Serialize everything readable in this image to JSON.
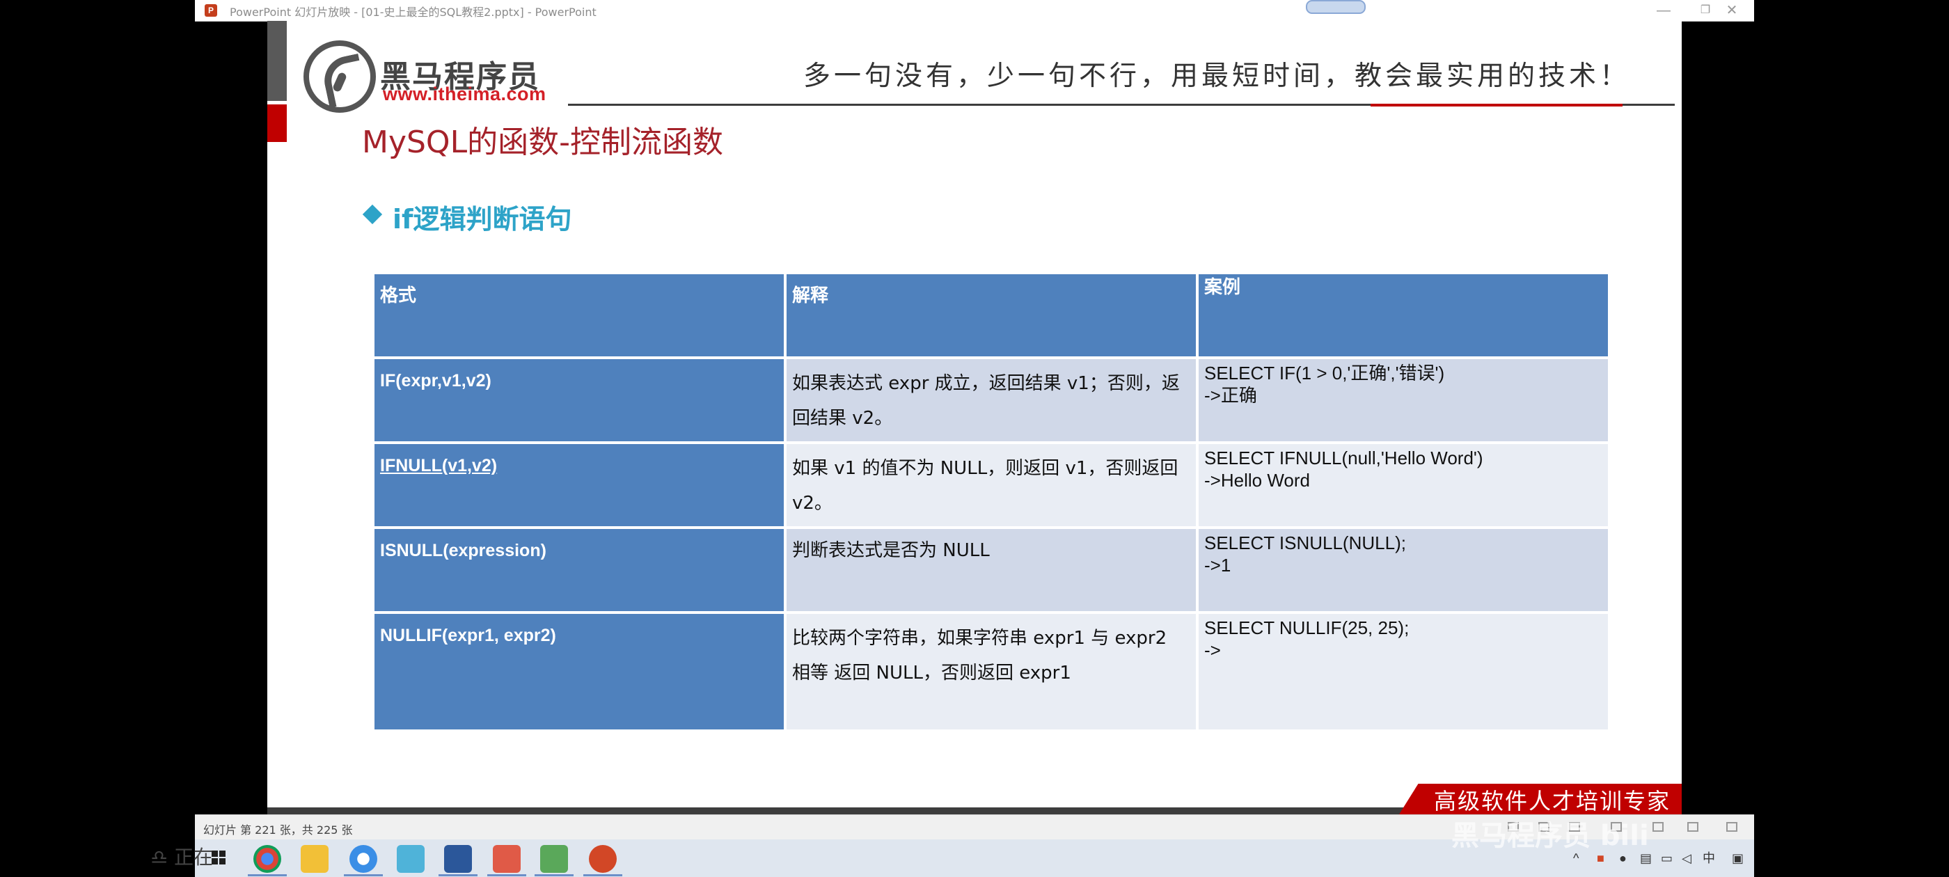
{
  "window": {
    "title": "PowerPoint 幻灯片放映 - [01-史上最全的SQL教程2.pptx] - PowerPoint",
    "app_icon": "P",
    "minimize": "—",
    "restore": "❐",
    "close": "✕"
  },
  "slide": {
    "logo_name": "黑马程序员",
    "logo_url": "www.itheima.com",
    "slogan": "多一句没有，少一句不行，用最短时间，教会最实用的技术！",
    "title": "MySQL的函数-控制流函数",
    "subtitle": "if逻辑判断语句",
    "footer": "高级软件人才培训专家",
    "table": {
      "headers": [
        "格式",
        "解释",
        "案例"
      ],
      "rows": [
        {
          "format": "IF(expr,v1,v2)",
          "explain": "如果表达式 expr 成立，返回结果 v1；否则，返回结果 v2。",
          "example_1": "SELECT IF(1 > 0,'正确','错误')",
          "example_2": "->正确"
        },
        {
          "format": "IFNULL(v1,v2)",
          "explain": "如果 v1 的值不为 NULL，则返回 v1，否则返回 v2。",
          "example_1": "SELECT IFNULL(null,'Hello Word')",
          "example_2": "->Hello Word"
        },
        {
          "format": "ISNULL(expression)",
          "explain": "判断表达式是否为 NULL",
          "example_1": "SELECT ISNULL(NULL);",
          "example_2": "->1"
        },
        {
          "format": "NULLIF(expr1, expr2)",
          "explain": "比较两个字符串，如果字符串 expr1 与 expr2 相等 返回 NULL，否则返回 expr1",
          "example_1": "SELECT NULLIF(25, 25);",
          "example_2": "->"
        }
      ]
    }
  },
  "status_bar": {
    "slide_info": "幻灯片 第 221 张，共 225 张"
  },
  "overlay": {
    "side_text": "♎ 正在",
    "watermark": "黑马程序员 bili"
  }
}
